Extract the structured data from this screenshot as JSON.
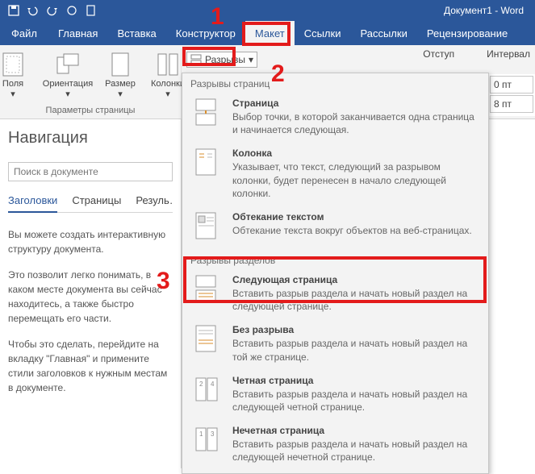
{
  "title": "Документ1 - Word",
  "qat": {
    "save": "save",
    "undo": "undo",
    "redo": "redo",
    "touch": "touch",
    "new": "new"
  },
  "menu": {
    "file": "Файл",
    "home": "Главная",
    "insert": "Вставка",
    "design": "Конструктор",
    "layout": "Макет",
    "references": "Ссылки",
    "mailings": "Рассылки",
    "review": "Рецензирование"
  },
  "ribbon": {
    "margins": "Поля",
    "orientation": "Ориентация",
    "size": "Размер",
    "columns": "Колонки",
    "page_setup_group": "Параметры страницы",
    "breaks_btn": "Разрывы",
    "indent_label": "Отступ",
    "spacing_label": "Интервал",
    "val0": "0 пт",
    "val8": "8 пт"
  },
  "nav": {
    "title": "Навигация",
    "search_placeholder": "Поиск в документе",
    "tab_headings": "Заголовки",
    "tab_pages": "Страницы",
    "tab_results": "Результаты",
    "p1": "Вы можете создать интерактивную структуру документа.",
    "p2": "Это позволит легко понимать, в каком месте документа вы сейчас находитесь, а также быстро перемещать его части.",
    "p3": "Чтобы это сделать, перейдите на вкладку \"Главная\" и примените стили заголовков к нужным местам в документе."
  },
  "dropdown": {
    "section1": "Разрывы страниц",
    "section2": "Разрывы разделов",
    "items1": [
      {
        "title": "Страница",
        "desc": "Выбор точки, в которой заканчивается одна страница и начинается следующая."
      },
      {
        "title": "Колонка",
        "desc": "Указывает, что текст, следующий за разрывом колонки, будет перенесен в начало следующей колонки."
      },
      {
        "title": "Обтекание текстом",
        "desc": "Обтекание текста вокруг объектов на веб-страницах."
      }
    ],
    "items2": [
      {
        "title": "Следующая страница",
        "desc": "Вставить разрыв раздела и начать новый раздел на следующей странице."
      },
      {
        "title": "Без разрыва",
        "desc": "Вставить разрыв раздела и начать новый раздел на той же странице."
      },
      {
        "title": "Четная страница",
        "desc": "Вставить разрыв раздела и начать новый раздел на следующей четной странице."
      },
      {
        "title": "Нечетная страница",
        "desc": "Вставить разрыв раздела и начать новый раздел на следующей нечетной странице."
      }
    ]
  },
  "annotations": {
    "n1": "1",
    "n2": "2",
    "n3": "3"
  }
}
